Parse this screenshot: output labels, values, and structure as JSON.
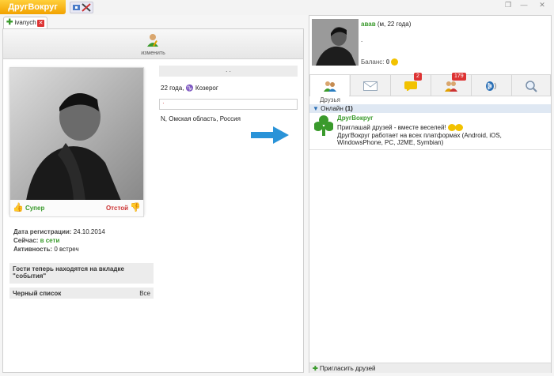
{
  "app": {
    "logo": "ДругВокруг"
  },
  "tab": {
    "label": "ivanych",
    "close": "✕"
  },
  "profile": {
    "edit_label": "изменить",
    "like_label": "Супер",
    "dislike_label": "Отстой",
    "reg_label": "Дата регистрации:",
    "reg_value": "24.10.2014",
    "now_label": "Сейчас:",
    "now_value": "в сети",
    "activity_label": "Активность:",
    "activity_value": "0 встреч",
    "guests_notice": "Гости теперь находятся на вкладке \"события\"",
    "blacklist_label": "Черный список",
    "blacklist_value": "Все",
    "dots": ". .",
    "age_sign": "22 года,",
    "zodiac": "Козерог",
    "field_mark": "·",
    "location": "N, Омская область, Россия"
  },
  "user": {
    "name": "авав",
    "details": "(м, 22 года)",
    "status": ".",
    "balance_label": "Баланс:",
    "balance_value": "0"
  },
  "tabs": {
    "badge_messages": "2",
    "badge_events": "179"
  },
  "friends": {
    "section_label": "Друзья",
    "online_label": "Онлайн",
    "online_count": "(1)"
  },
  "contact": {
    "name": "ДругВокруг",
    "line1": "Приглашай друзей - вместе веселей!",
    "line2": "ДругВокруг работает на всех платформах (Android, iOS, WindowsPhone, PC, J2ME, Symbian)"
  },
  "footer": {
    "invite_label": "Пригласить друзей"
  },
  "colors": {
    "accent": "#f2a200",
    "green": "#3a9a2c",
    "arrow": "#2a93d8",
    "badge": "#d33"
  }
}
